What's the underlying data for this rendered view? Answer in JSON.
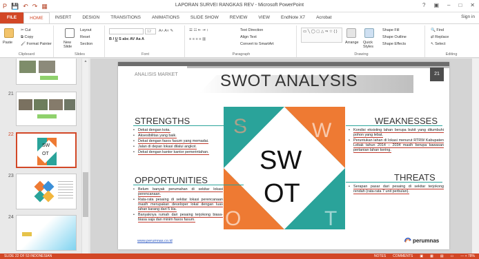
{
  "window": {
    "title": "LAPORAN SURVEI RANGKAS REV - Microsoft PowerPoint",
    "controls": [
      "?",
      "▣",
      "–",
      "□",
      "✕"
    ]
  },
  "quick_access": [
    "P",
    "💾",
    "↶",
    "↷",
    "▦"
  ],
  "tabs": [
    "FILE",
    "HOME",
    "INSERT",
    "DESIGN",
    "TRANSITIONS",
    "ANIMATIONS",
    "SLIDE SHOW",
    "REVIEW",
    "VIEW",
    "EndNote X7",
    "Acrobat"
  ],
  "active_tab": "HOME",
  "sign_in": "Sign in",
  "ribbon": {
    "clipboard": {
      "name": "Clipboard",
      "paste": "Paste",
      "cut": "Cut",
      "copy": "Copy",
      "format_painter": "Format Painter"
    },
    "slides": {
      "name": "Slides",
      "new_slide": "New Slide",
      "layout": "Layout",
      "reset": "Reset",
      "section": "Section"
    },
    "font": {
      "name": "Font",
      "font_value": "",
      "size_value": "12"
    },
    "paragraph": {
      "name": "Paragraph",
      "text_direction": "Text Direction",
      "align_text": "Align Text",
      "smartart": "Convert to SmartArt"
    },
    "drawing": {
      "name": "Drawing",
      "arrange": "Arrange",
      "quick_styles": "Quick Styles",
      "shape_fill": "Shape Fill",
      "shape_outline": "Shape Outline",
      "shape_effects": "Shape Effects"
    },
    "editing": {
      "name": "Editing",
      "find": "Find",
      "replace": "Replace",
      "select": "Select"
    }
  },
  "thumbnails": [
    {
      "num": "",
      "selected": false
    },
    {
      "num": "21",
      "selected": false
    },
    {
      "num": "22",
      "selected": true
    },
    {
      "num": "23",
      "selected": false
    },
    {
      "num": "24",
      "selected": false
    }
  ],
  "slide": {
    "section_label": "ANALISIS MARKET",
    "title": "SWOT ANALYSIS",
    "slide_number": "21",
    "swot_big": [
      "SW",
      "OT"
    ],
    "swot_letters": [
      "S",
      "W",
      "O",
      "T"
    ],
    "strengths": {
      "heading": "STRENGTHS",
      "items": [
        "Dekat dengan kota.",
        "Aksesibilitas yang baik.",
        "Dekat dengan fasos fasum yang memadai.",
        "Jalan di depan lokasi dilalui angkot.",
        "Dekat dengan kantor kantor pemerintahan."
      ]
    },
    "weaknesses": {
      "heading": "WEAKNESSES",
      "items": [
        "Kondisi eksisting lahan berupa bukit yang ditumbuhi pohon yang lebat.",
        "Peruntukan lahan di lokasi menurut RTRW Kabupaten Lebak tahun 2014 – 2034 masih berupa kawasan pertanian lahan kering."
      ]
    },
    "opportunities": {
      "heading": "OPPORTUNITIES",
      "items": [
        "Belum banyak perumahan di sekitar lokasi perencanaan.",
        "Rata-rata pesaing di sekitar lokasi perencanaan masih merupakan developer lokal dengan luas lahan karang dari 5 Ha.",
        "Banyaknya rumah dari pesaing terjokong biasa-biasa saja dan minim fasos fasum."
      ]
    },
    "threats": {
      "heading": "THREATS",
      "items": [
        "Serapan pasar dari pesaing di sekitar terjokong rendah (rata-rata 7 unit perbulan)."
      ]
    },
    "footer_url": "www.perumnas.co.id",
    "logo_text": "perumnas"
  },
  "status": {
    "left": "SLIDE 22 OF 53     INDONESIAN",
    "right": [
      "NOTES",
      "COMMENTS",
      "▣",
      "▦",
      "▤",
      "▭",
      "— + 78%"
    ]
  },
  "colors": {
    "accent": "#d24726",
    "teal": "#2aa39a",
    "orange": "#ee7a33"
  }
}
